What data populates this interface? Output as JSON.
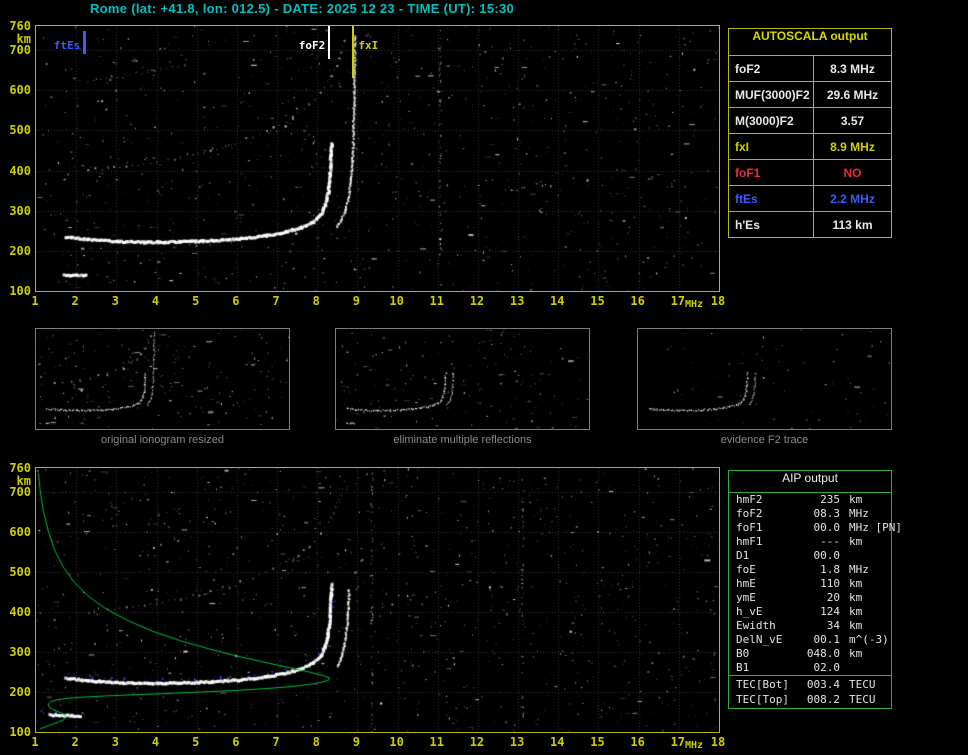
{
  "header": {
    "title": "Rome (lat: +41.8, lon: 012.5) - DATE: 2025 12 23 - TIME (UT): 15:30"
  },
  "colors": {
    "title": "#00c0c0",
    "axis": "#cfcf00",
    "plot_border": "#b8b800",
    "autoscala_border": "#b8b800",
    "aip_border": "#2fae2f",
    "caption": "#8a8a8a",
    "profile_green": "#00c040",
    "restored_blue": "#2e40ff",
    "ftEs_blue": "#3a5cff",
    "foF1_red": "#e83030"
  },
  "autoscala": {
    "title": "AUTOSCALA output",
    "rows": [
      {
        "label": "foF2",
        "value": "8.3 MHz",
        "color": "#e8e8e8"
      },
      {
        "label": "MUF(3000)F2",
        "value": "29.6 MHz",
        "color": "#e8e8e8"
      },
      {
        "label": "M(3000)F2",
        "value": "3.57",
        "color": "#e8e8e8"
      },
      {
        "label": "fxI",
        "value": "8.9 MHz",
        "color": "#d0d000"
      },
      {
        "label": "foF1",
        "value": "NO",
        "color": "#e83030"
      },
      {
        "label": "ftEs",
        "value": "2.2 MHz",
        "color": "#3a5cff"
      },
      {
        "label": "h'Es",
        "value": "113  km",
        "color": "#e8e8e8"
      }
    ]
  },
  "thumbnails": [
    {
      "caption": "original ionogram resized"
    },
    {
      "caption": "eliminate multiple reflections"
    },
    {
      "caption": "evidence F2 trace"
    }
  ],
  "aip": {
    "title": "AIP output",
    "rows": [
      {
        "label": "hmF2",
        "value": "235",
        "unit": "km"
      },
      {
        "label": "foF2",
        "value": "08.3",
        "unit": "MHz"
      },
      {
        "label": "foF1",
        "value": "00.0",
        "unit": "MHz  [PN]"
      },
      {
        "label": "hmF1",
        "value": "---",
        "unit": "km"
      },
      {
        "label": "D1",
        "value": "00.0",
        "unit": ""
      },
      {
        "label": "foE",
        "value": "1.8",
        "unit": "MHz"
      },
      {
        "label": "hmE",
        "value": "110",
        "unit": "km"
      },
      {
        "label": "ymE",
        "value": "20",
        "unit": "km"
      },
      {
        "label": "h_vE",
        "value": "124",
        "unit": "km"
      },
      {
        "label": "Ewidth",
        "value": "34",
        "unit": "km"
      },
      {
        "label": "DelN_vE",
        "value": "00.1",
        "unit": "m^(-3)"
      },
      {
        "label": "B0",
        "value": "048.0",
        "unit": "km"
      },
      {
        "label": "B1",
        "value": "02.0",
        "unit": ""
      }
    ],
    "tec_rows": [
      {
        "label": "TEC[Bot]",
        "value": "003.4",
        "unit": "TECU"
      },
      {
        "label": "TEC[Top]",
        "value": "008.2",
        "unit": "TECU"
      }
    ]
  },
  "top_markers": [
    {
      "label": "ftEs",
      "freq": 2.2,
      "color": "#3a5cff",
      "side": "left",
      "bar": [
        5,
        28
      ],
      "width": 3
    },
    {
      "label": "foF2",
      "freq": 8.3,
      "color": "#ffffff",
      "side": "left",
      "bar": [
        0,
        33
      ],
      "width": 2
    },
    {
      "label": "fxI",
      "freq": 8.9,
      "color": "#d0d000",
      "side": "right",
      "bar": [
        0,
        52
      ],
      "width": 2
    }
  ],
  "chart_data": [
    {
      "id": "top_ionogram",
      "type": "scatter",
      "title": "scaled ionogram with autoscala traces",
      "xlabel": "MHz",
      "ylabel": "km",
      "xlim": [
        1,
        18
      ],
      "ylim": [
        100,
        760
      ],
      "x_ticks": [
        1,
        2,
        3,
        4,
        5,
        6,
        7,
        8,
        9,
        10,
        11,
        12,
        13,
        14,
        15,
        16,
        17,
        18
      ],
      "y_ticks": [
        760,
        700,
        600,
        500,
        400,
        300,
        200,
        100
      ],
      "grid": true,
      "noise": {
        "seed": 11,
        "count": 1150,
        "columns": [
          11.05
        ]
      },
      "series": [
        {
          "name": "third_hop_trace",
          "color": "#8a8a8a",
          "width": 1,
          "style": "dots",
          "points": [
            [
              2.3,
              622
            ],
            [
              2.9,
              632
            ],
            [
              3.5,
              642
            ],
            [
              4.1,
              652
            ],
            [
              4.7,
              662
            ]
          ]
        },
        {
          "name": "second_hop_trace",
          "color": "#b0b0b0",
          "width": 2,
          "style": "dots",
          "points": [
            [
              2.3,
              400
            ],
            [
              2.8,
              406
            ],
            [
              3.4,
              413
            ],
            [
              4.0,
              422
            ],
            [
              4.6,
              433
            ],
            [
              5.2,
              447
            ],
            [
              5.8,
              463
            ],
            [
              6.4,
              483
            ],
            [
              6.9,
              505
            ],
            [
              7.4,
              532
            ],
            [
              7.8,
              562
            ],
            [
              8.1,
              595
            ],
            [
              8.35,
              635
            ],
            [
              8.55,
              678
            ],
            [
              8.68,
              722
            ]
          ]
        },
        {
          "name": "f2_ordinary_trace",
          "color": "#ffffff",
          "width": 3,
          "style": "scatter",
          "points": [
            [
              1.75,
              234
            ],
            [
              2.3,
              228
            ],
            [
              3.0,
              223
            ],
            [
              3.8,
              221
            ],
            [
              4.6,
              222
            ],
            [
              5.4,
              225
            ],
            [
              6.1,
              230
            ],
            [
              6.7,
              237
            ],
            [
              7.2,
              246
            ],
            [
              7.6,
              257
            ],
            [
              7.9,
              271
            ],
            [
              8.1,
              290
            ],
            [
              8.2,
              313
            ],
            [
              8.28,
              345
            ],
            [
              8.32,
              390
            ],
            [
              8.35,
              440
            ],
            [
              8.37,
              468
            ]
          ]
        },
        {
          "name": "f2_extraordinary_trace",
          "color": "#f0f0f0",
          "width": 2,
          "style": "scatter",
          "points": [
            [
              8.48,
              258
            ],
            [
              8.6,
              276
            ],
            [
              8.7,
              300
            ],
            [
              8.78,
              332
            ],
            [
              8.84,
              375
            ],
            [
              8.88,
              425
            ],
            [
              8.9,
              470
            ]
          ]
        },
        {
          "name": "fxI_spread_streak",
          "color": "#e0e0e0",
          "width": 2,
          "style": "scatter",
          "points": [
            [
              8.9,
              480
            ],
            [
              8.92,
              560
            ],
            [
              8.93,
              650
            ],
            [
              8.94,
              735
            ]
          ]
        },
        {
          "name": "sporadic_e_trace",
          "color": "#ffffff",
          "width": 3,
          "style": "scatter",
          "points": [
            [
              1.7,
              139
            ],
            [
              2.25,
              139
            ]
          ]
        }
      ]
    },
    {
      "id": "bottom_ionogram",
      "type": "scatter",
      "title": "ionogram with restored trace and electron density profile",
      "xlabel": "MHz",
      "ylabel": "km",
      "xlim": [
        1,
        18
      ],
      "ylim": [
        100,
        760
      ],
      "x_ticks": [
        1,
        2,
        3,
        4,
        5,
        6,
        7,
        8,
        9,
        10,
        11,
        12,
        13,
        14,
        15,
        16,
        17,
        18
      ],
      "y_ticks": [
        760,
        700,
        600,
        500,
        400,
        300,
        200,
        100
      ],
      "grid": true,
      "noise": {
        "seed": 29,
        "count": 1250,
        "columns": [
          9.35,
          13.1
        ]
      },
      "series": [
        {
          "name": "second_hop_trace",
          "color": "#a8a8a8",
          "width": 2,
          "style": "dots",
          "points": [
            [
              2.3,
              400
            ],
            [
              2.8,
              406
            ],
            [
              3.4,
              413
            ],
            [
              4.0,
              422
            ],
            [
              4.6,
              433
            ],
            [
              5.2,
              447
            ],
            [
              5.8,
              463
            ],
            [
              6.4,
              483
            ],
            [
              6.9,
              505
            ],
            [
              7.4,
              532
            ],
            [
              7.8,
              562
            ],
            [
              8.1,
              595
            ],
            [
              8.35,
              635
            ],
            [
              8.55,
              678
            ],
            [
              8.68,
              722
            ]
          ]
        },
        {
          "name": "restored_trace_blue",
          "color": "#2e40ff",
          "width": 2,
          "style": "dots",
          "points": [
            [
              1.8,
              243
            ],
            [
              2.4,
              237
            ],
            [
              3.2,
              232
            ],
            [
              4.0,
              230
            ],
            [
              4.8,
              231
            ],
            [
              5.6,
              235
            ],
            [
              6.3,
              241
            ],
            [
              6.9,
              249
            ],
            [
              7.4,
              259
            ],
            [
              7.8,
              273
            ],
            [
              8.05,
              293
            ],
            [
              8.2,
              318
            ],
            [
              8.3,
              352
            ],
            [
              8.38,
              392
            ],
            [
              8.44,
              430
            ]
          ]
        },
        {
          "name": "restored_es_blue",
          "color": "#2e40ff",
          "width": 2,
          "style": "dots",
          "points": [
            [
              1.15,
              152
            ],
            [
              1.5,
              148
            ],
            [
              1.9,
              146
            ],
            [
              2.2,
              145
            ]
          ]
        },
        {
          "name": "f2_ordinary_trace",
          "color": "#ffffff",
          "width": 3,
          "style": "scatter",
          "points": [
            [
              1.75,
              234
            ],
            [
              2.3,
              228
            ],
            [
              3.0,
              223
            ],
            [
              3.8,
              221
            ],
            [
              4.6,
              222
            ],
            [
              5.4,
              225
            ],
            [
              6.1,
              230
            ],
            [
              6.7,
              237
            ],
            [
              7.2,
              246
            ],
            [
              7.6,
              257
            ],
            [
              7.9,
              271
            ],
            [
              8.1,
              290
            ],
            [
              8.2,
              313
            ],
            [
              8.28,
              345
            ],
            [
              8.32,
              390
            ],
            [
              8.35,
              440
            ],
            [
              8.37,
              468
            ]
          ]
        },
        {
          "name": "f2_extraordinary_trace",
          "color": "#f0f0f0",
          "width": 2,
          "style": "scatter",
          "points": [
            [
              8.5,
              262
            ],
            [
              8.6,
              284
            ],
            [
              8.68,
              315
            ],
            [
              8.74,
              358
            ],
            [
              8.78,
              410
            ],
            [
              8.8,
              455
            ]
          ]
        },
        {
          "name": "sporadic_e_trace",
          "color": "#ffffff",
          "width": 3,
          "style": "scatter",
          "points": [
            [
              1.35,
              142
            ],
            [
              2.1,
              140
            ]
          ]
        },
        {
          "name": "electron_density_profile",
          "color": "#00c040",
          "width": 1,
          "style": "line",
          "points": [
            [
              1.06,
              748
            ],
            [
              1.1,
              706
            ],
            [
              1.18,
              655
            ],
            [
              1.3,
              604
            ],
            [
              1.46,
              556
            ],
            [
              1.68,
              512
            ],
            [
              1.97,
              472
            ],
            [
              2.33,
              437
            ],
            [
              2.77,
              406
            ],
            [
              3.3,
              378
            ],
            [
              3.9,
              352
            ],
            [
              4.6,
              328
            ],
            [
              5.3,
              308
            ],
            [
              6.0,
              290
            ],
            [
              6.7,
              274
            ],
            [
              7.3,
              261
            ],
            [
              7.8,
              250
            ],
            [
              8.15,
              241
            ],
            [
              8.3,
              236
            ],
            [
              8.28,
              229
            ],
            [
              8.0,
              222
            ],
            [
              7.5,
              215
            ],
            [
              6.8,
              209
            ],
            [
              6.0,
              204
            ],
            [
              5.1,
              200
            ],
            [
              4.2,
              196
            ],
            [
              3.4,
              193
            ],
            [
              2.7,
              190
            ],
            [
              2.15,
              187
            ],
            [
              1.75,
              184
            ],
            [
              1.5,
              180
            ],
            [
              1.36,
              175
            ],
            [
              1.3,
              169
            ],
            [
              1.33,
              162
            ],
            [
              1.43,
              156
            ],
            [
              1.57,
              150
            ],
            [
              1.7,
              144
            ],
            [
              1.76,
              138
            ],
            [
              1.7,
              131
            ],
            [
              1.56,
              125
            ],
            [
              1.4,
              119
            ],
            [
              1.24,
              113
            ],
            [
              1.1,
              108
            ]
          ]
        }
      ]
    },
    {
      "id": "thumb_original",
      "type": "scatter",
      "base": "top_ionogram",
      "grid": false,
      "noise": {
        "seed": 3,
        "count": 240
      },
      "series_names": [
        "second_hop_trace",
        "f2_ordinary_trace",
        "f2_extraordinary_trace",
        "fxI_spread_streak",
        "sporadic_e_trace"
      ]
    },
    {
      "id": "thumb_clean",
      "type": "scatter",
      "base": "top_ionogram",
      "grid": false,
      "noise": {
        "seed": 5,
        "count": 210
      },
      "series_names": [
        "f2_ordinary_trace",
        "f2_extraordinary_trace",
        "sporadic_e_trace"
      ]
    },
    {
      "id": "thumb_f2",
      "type": "scatter",
      "base": "top_ionogram",
      "grid": false,
      "noise": {
        "seed": 9,
        "count": 80
      },
      "series_names": [
        "f2_ordinary_trace",
        "f2_extraordinary_trace"
      ]
    }
  ]
}
